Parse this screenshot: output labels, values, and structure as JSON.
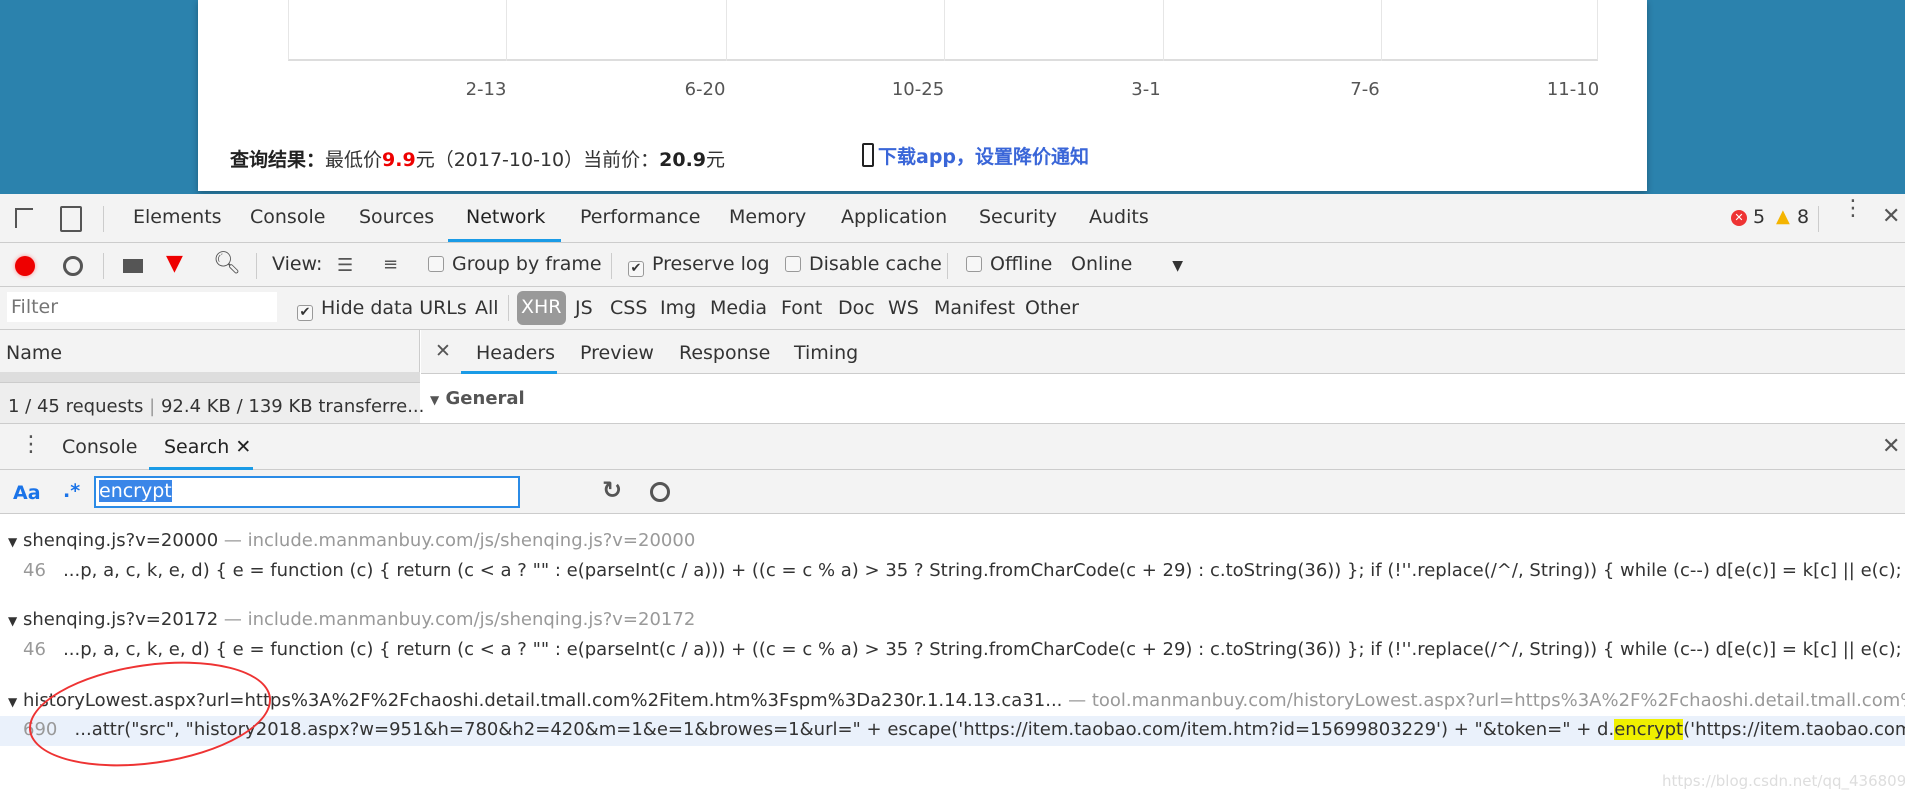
{
  "webpage": {
    "x_labels": [
      "2-13",
      "6-20",
      "10-25",
      "3-1",
      "7-6",
      "11-10"
    ],
    "result_label": "查询结果：",
    "lowest_label": "最低价",
    "lowest_price": "9.9",
    "lowest_suffix": "元（2017-10-10）当前价：",
    "current_price": "20.9",
    "current_suffix": "元",
    "app_link": "下载app，设置降价通知"
  },
  "devtools": {
    "tabs": [
      "Elements",
      "Console",
      "Sources",
      "Network",
      "Performance",
      "Memory",
      "Application",
      "Security",
      "Audits"
    ],
    "active_tab": "Network",
    "errors": "5",
    "warnings": "8",
    "toolbar": {
      "view_label": "View:",
      "group_by_frame": "Group by frame",
      "preserve_log": "Preserve log",
      "disable_cache": "Disable cache",
      "offline": "Offline",
      "throttle": "Online"
    },
    "filter": {
      "placeholder": "Filter",
      "hide_data_urls": "Hide data URLs",
      "types": [
        "All",
        "XHR",
        "JS",
        "CSS",
        "Img",
        "Media",
        "Font",
        "Doc",
        "WS",
        "Manifest",
        "Other"
      ],
      "active_type": "XHR"
    },
    "name_header": "Name",
    "detail_tabs": [
      "Headers",
      "Preview",
      "Response",
      "Timing"
    ],
    "status": "1 / 45 requests",
    "transferred": "92.4 KB / 139 KB transferre...",
    "general": "General",
    "drawer_tabs": [
      "Console",
      "Search"
    ],
    "search": {
      "case_label": "Aa",
      "regex_label": ".*",
      "query": "encrypt"
    },
    "results": [
      {
        "file": "shenqing.js?v=20000",
        "url": "— include.manmanbuy.com/js/shenqing.js?v=20000",
        "line": "46",
        "code": "...p, a, c, k, e, d) { e = function (c) { return (c < a ? \"\" : e(parseInt(c / a))) + ((c = c % a) > 35 ? String.fromCharCode(c + 29) : c.toString(36)) }; if (!''.replace(/^/, String)) { while (c--) d[e(c)] = k[c] || e(c); k = [function (e) ..."
      },
      {
        "file": "shenqing.js?v=20172",
        "url": "— include.manmanbuy.com/js/shenqing.js?v=20172",
        "line": "46",
        "code": "...p, a, c, k, e, d) { e = function (c) { return (c < a ? \"\" : e(parseInt(c / a))) + ((c = c % a) > 35 ? String.fromCharCode(c + 29) : c.toString(36)) }; if (!''.replace(/^/, String)) { while (c--) d[e(c)] = k[c] || e(c); k = [function (e) ..."
      },
      {
        "file": "historyLowest.aspx?url=https%3A%2F%2Fchaoshi.detail.tmall.com%2Fitem.htm%3Fspm%3Da230r.1.14.13.ca31...",
        "url": "— tool.manmanbuy.com/historyLowest.aspx?url=https%3A%2F%2Fchaoshi.detail.tmall.com%2Fitem.h...",
        "line": "690",
        "code_before": "...attr(\"src\", \"history2018.aspx?w=951&h=780&h2=420&m=1&e=1&browes=1&url=\" + escape('https://item.taobao.com/item.htm?id=15699803229') + \"&token=\" + d.",
        "match": "encrypt",
        "code_after": "('https://item.taobao.com/item.ht..."
      }
    ]
  },
  "watermark": "https://blog.csdn.net/qq_43680930"
}
